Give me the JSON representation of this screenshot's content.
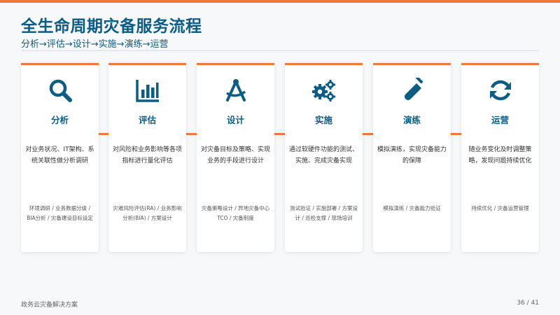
{
  "title": "全生命周期灾备服务流程",
  "subtitle": "分析→评估→设计→实施→演练→运营",
  "colors": {
    "accent": "#f07a3a",
    "primary": "#0b5d86"
  },
  "cards": [
    {
      "icon": "search-icon",
      "title": "分析",
      "desc": "对业务状况、IT架构、系统关联性做分析调研",
      "tags": "环境调研 / 业务数据分级 / BIA分析 / 灾备建设目标设定"
    },
    {
      "icon": "bar-chart-icon",
      "title": "评估",
      "desc": "对风险和业务影响等各项指标进行量化评估",
      "tags": "灾难风险评估(RA) / 业务影响分析(BIA) / 方案设计"
    },
    {
      "icon": "compass-icon",
      "title": "设计",
      "desc": "对灾备目标及策略、实现业务的手段进行设计",
      "tags": "灾备策略设计 / 异地灾备中心TCO / 灾备制度"
    },
    {
      "icon": "gears-icon",
      "title": "实施",
      "desc": "通过软硬件功能的测试、实施、完成灾备实现",
      "tags": "测试验证 / 实施部署 / 方案设计 / 巡检支撑 / 现场培训"
    },
    {
      "icon": "test-tube-icon",
      "title": "演练",
      "desc": "模拟演练，实现灾备能力的保障",
      "tags": "模拟演练 / 灾备能力验证"
    },
    {
      "icon": "sync-icon",
      "title": "运营",
      "desc": "随业务变化及时调整策略，发现问题持续优化",
      "tags": "持续优化 / 灾备运营管理"
    }
  ],
  "footer": {
    "left": "政务云灾备解决方案",
    "page": "36 / 41"
  }
}
